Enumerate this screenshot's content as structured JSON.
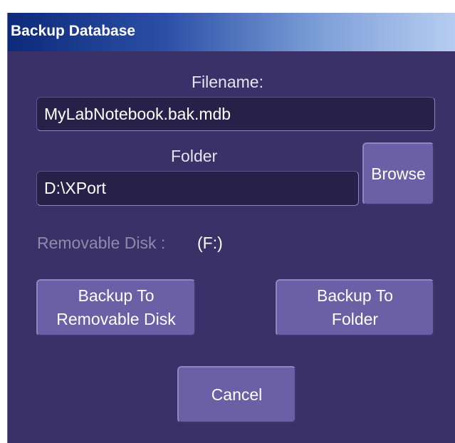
{
  "dialog": {
    "title": "Backup Database"
  },
  "filename": {
    "label": "Filename:",
    "value": "MyLabNotebook.bak.mdb"
  },
  "folder": {
    "label": "Folder",
    "value": "D:\\XPort",
    "browse_label": "Browse"
  },
  "removable_disk": {
    "label": "Removable Disk :",
    "value": "(F:)"
  },
  "buttons": {
    "backup_removable_line1": "Backup To",
    "backup_removable_line2": "Removable Disk",
    "backup_folder_line1": "Backup To",
    "backup_folder_line2": "Folder",
    "cancel": "Cancel"
  },
  "colors": {
    "dialog_background": "#3b3169",
    "field_background": "#272149",
    "button_background": "#6b5fa6",
    "title_gradient_start": "#0d2a7a",
    "title_gradient_end": "#b7cdf1"
  }
}
